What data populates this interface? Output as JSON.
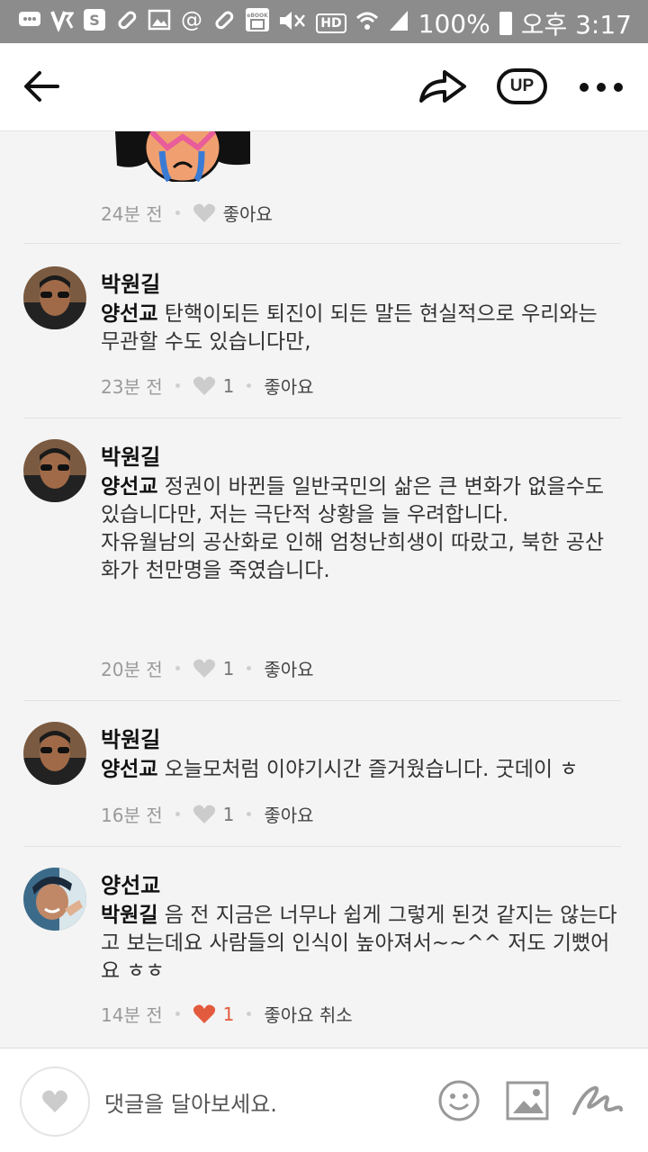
{
  "status_bar": {
    "hd": "HD",
    "battery": "100%",
    "time": "오후 3:17",
    "ebook": "eBOOK"
  },
  "app_bar": {
    "up_label": "UP"
  },
  "top_item": {
    "time": "24분 전",
    "like_label": "좋아요"
  },
  "comments": [
    {
      "author": "박원길",
      "mention": "양선교",
      "text": "탄핵이되든 퇴진이 되든 말든 현실적으로 우리와는 무관할 수도 있습니다만,",
      "time": "23분 전",
      "likes": "1",
      "like_label": "좋아요"
    },
    {
      "author": "박원길",
      "mention": "양선교",
      "text": "정권이 바뀐들 일반국민의 삶은 큰 변화가 없을수도 있습니다만, 저는 극단적 상황을 늘 우려합니다.",
      "text2": "자유월남의 공산화로 인해 엄청난희생이 따랐고, 북한 공산화가 천만명을 죽였습니다.",
      "time": "20분 전",
      "likes": "1",
      "like_label": "좋아요"
    },
    {
      "author": "박원길",
      "mention": "양선교",
      "text": "오늘모처럼 이야기시간 즐거웠습니다. 굿데이 ㅎ",
      "time": "16분 전",
      "likes": "1",
      "like_label": "좋아요"
    },
    {
      "author": "양선교",
      "mention": "박원길",
      "text": "음 전 지금은 너무나 쉽게 그렇게 된것 같지는 않는다고 보는데요 사람들의 인식이 높아져서~~^^ 저도 기뻤어요 ㅎㅎ",
      "time": "14분 전",
      "likes": "1",
      "like_label": "좋아요 취소"
    }
  ],
  "input_bar": {
    "placeholder": "댓글을 달아보세요."
  },
  "colors": {
    "liked_heart": "#e35b3e",
    "heart": "#cccccc"
  }
}
